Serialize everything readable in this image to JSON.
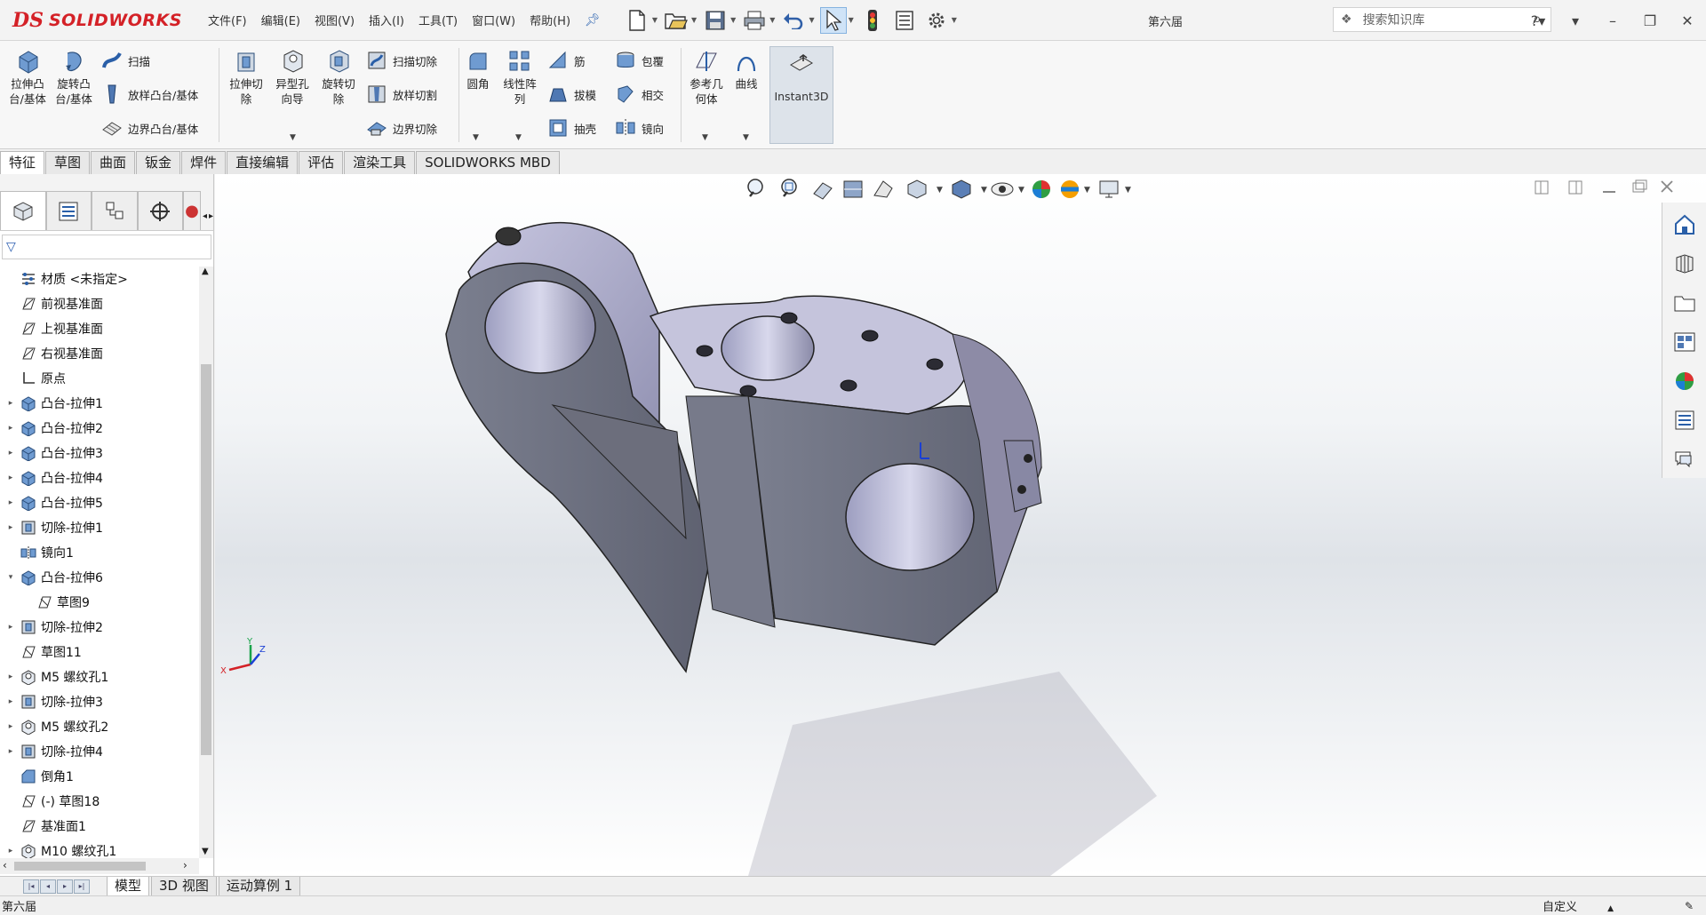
{
  "app": {
    "brand_mark": "DS",
    "brand": "SOLIDWORKS",
    "doc_title": "第六届"
  },
  "menu": [
    "文件(F)",
    "编辑(E)",
    "视图(V)",
    "插入(I)",
    "工具(T)",
    "窗口(W)",
    "帮助(H)"
  ],
  "search": {
    "placeholder": "搜索知识库"
  },
  "ribbon": {
    "extrude_boss": "拉伸凸台/基体",
    "revolve_boss": "旋转凸台/基体",
    "sweep": "扫描",
    "loft_boss": "放样凸台/基体",
    "boundary_boss": "边界凸台/基体",
    "extrude_cut": "拉伸切除",
    "hole_wizard": "异型孔向导",
    "revolve_cut": "旋转切除",
    "sweep_cut": "扫描切除",
    "loft_cut": "放样切割",
    "boundary_cut": "边界切除",
    "fillet": "圆角",
    "linear_pattern": "线性阵列",
    "rib": "筋",
    "draft": "拔模",
    "shell": "抽壳",
    "wrap": "包覆",
    "intersect": "相交",
    "mirror": "镜向",
    "ref_geometry": "参考几何体",
    "curves": "曲线",
    "instant3d": "Instant3D"
  },
  "tabs": [
    "特征",
    "草图",
    "曲面",
    "钣金",
    "焊件",
    "直接编辑",
    "评估",
    "渲染工具",
    "SOLIDWORKS MBD"
  ],
  "tree": [
    {
      "label": "材质 <未指定>",
      "expand": ""
    },
    {
      "label": "前视基准面",
      "expand": ""
    },
    {
      "label": "上视基准面",
      "expand": ""
    },
    {
      "label": "右视基准面",
      "expand": ""
    },
    {
      "label": "原点",
      "expand": ""
    },
    {
      "label": "凸台-拉伸1",
      "expand": "▸"
    },
    {
      "label": "凸台-拉伸2",
      "expand": "▸"
    },
    {
      "label": "凸台-拉伸3",
      "expand": "▸"
    },
    {
      "label": "凸台-拉伸4",
      "expand": "▸"
    },
    {
      "label": "凸台-拉伸5",
      "expand": "▸"
    },
    {
      "label": "切除-拉伸1",
      "expand": "▸"
    },
    {
      "label": "镜向1",
      "expand": ""
    },
    {
      "label": "凸台-拉伸6",
      "expand": "▾"
    },
    {
      "label": "草图9",
      "expand": ""
    },
    {
      "label": "切除-拉伸2",
      "expand": "▸"
    },
    {
      "label": "草图11",
      "expand": ""
    },
    {
      "label": "M5 螺纹孔1",
      "expand": "▸"
    },
    {
      "label": "切除-拉伸3",
      "expand": "▸"
    },
    {
      "label": "M5 螺纹孔2",
      "expand": "▸"
    },
    {
      "label": "切除-拉伸4",
      "expand": "▸"
    },
    {
      "label": "倒角1",
      "expand": ""
    },
    {
      "label": "(-) 草图18",
      "expand": ""
    },
    {
      "label": "基准面1",
      "expand": ""
    },
    {
      "label": "M10 螺纹孔1",
      "expand": "▸"
    }
  ],
  "triad": {
    "x": "X",
    "y": "Y",
    "z": "Z"
  },
  "bottom_tabs": [
    "模型",
    "3D 视图",
    "运动算例 1"
  ],
  "status": {
    "left": "第六届",
    "right": "自定义"
  }
}
